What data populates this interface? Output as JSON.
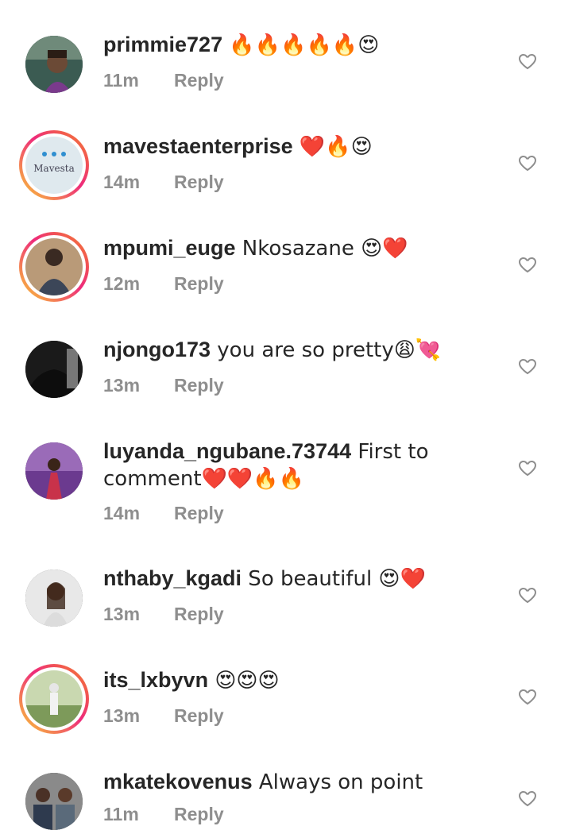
{
  "comments": [
    {
      "username": "primmie727",
      "text": " 🔥🔥🔥🔥🔥😍",
      "time": "11m",
      "reply": "Reply",
      "avatar": "person-avatar",
      "has_story_ring": false
    },
    {
      "username": "mavestaenterprise",
      "text": " ❤️🔥😍",
      "time": "14m",
      "reply": "Reply",
      "avatar": "brand-logo-avatar",
      "avatar_text": "Mavesta",
      "has_story_ring": true
    },
    {
      "username": "mpumi_euge",
      "text": " Nkosazane 😍❤️",
      "time": "12m",
      "reply": "Reply",
      "avatar": "person-avatar",
      "has_story_ring": true
    },
    {
      "username": "njongo173",
      "text": " you are so pretty😩💘",
      "time": "13m",
      "reply": "Reply",
      "avatar": "person-avatar",
      "has_story_ring": false
    },
    {
      "username": "luyanda_ngubane.73744",
      "text": " First to comment❤️❤️🔥🔥",
      "time": "14m",
      "reply": "Reply",
      "avatar": "person-avatar",
      "has_story_ring": false
    },
    {
      "username": "nthaby_kgadi",
      "text": " So beautiful 😍❤️",
      "time": "13m",
      "reply": "Reply",
      "avatar": "person-avatar",
      "has_story_ring": false
    },
    {
      "username": "its_lxbyvn",
      "text": " 😍😍😍",
      "time": "13m",
      "reply": "Reply",
      "avatar": "person-avatar",
      "has_story_ring": true
    },
    {
      "username": "mkatekovenus",
      "text": " Always on point",
      "time": "11m",
      "reply": "Reply",
      "avatar": "group-avatar",
      "has_story_ring": false
    }
  ],
  "colors": {
    "text": "#262626",
    "meta": "#8e8e8e",
    "like_outline": "#8e8e8e"
  },
  "icons": {
    "like": "heart-outline-icon"
  }
}
